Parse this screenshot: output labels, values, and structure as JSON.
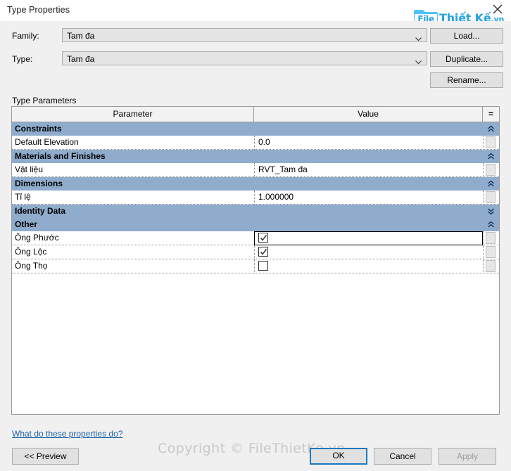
{
  "window": {
    "title": "Type Properties",
    "close_icon": "close-icon"
  },
  "logo": {
    "file_word": "File",
    "main_word": "Thiết Kế",
    "tld": ".vn",
    "color": "#29a3e0"
  },
  "form": {
    "family_label": "Family:",
    "family_value": "Tam đa",
    "type_label": "Type:",
    "type_value": "Tam đa",
    "load_button": "Load...",
    "duplicate_button": "Duplicate...",
    "rename_button": "Rename..."
  },
  "table": {
    "section_label": "Type Parameters",
    "columns": [
      "Parameter",
      "Value",
      "="
    ],
    "rows": [
      {
        "kind": "group",
        "label": "Constraints",
        "state": "expanded"
      },
      {
        "kind": "item",
        "label": "Default Elevation",
        "value": "0.0",
        "value_type": "text",
        "selected": false
      },
      {
        "kind": "group",
        "label": "Materials and Finishes",
        "state": "expanded"
      },
      {
        "kind": "item",
        "label": "Vật liệu",
        "value": "RVT_Tam đa",
        "value_type": "text",
        "selected": false
      },
      {
        "kind": "group",
        "label": "Dimensions",
        "state": "expanded"
      },
      {
        "kind": "item",
        "label": "Tỉ lệ",
        "value": "1.000000",
        "value_type": "text",
        "selected": false
      },
      {
        "kind": "group",
        "label": "Identity Data",
        "state": "collapsed"
      },
      {
        "kind": "group",
        "label": "Other",
        "state": "expanded"
      },
      {
        "kind": "item",
        "label": "Ông Phước",
        "value": "",
        "value_type": "checkbox",
        "checked": true,
        "selected": true
      },
      {
        "kind": "item",
        "label": "Ông Lộc",
        "value": "",
        "value_type": "checkbox",
        "checked": true,
        "selected": false
      },
      {
        "kind": "item",
        "label": "Ông Thọ",
        "value": "",
        "value_type": "checkbox",
        "checked": false,
        "selected": false
      }
    ]
  },
  "footer": {
    "help_link": "What do these properties do?",
    "preview_button": "<< Preview",
    "ok_button": "OK",
    "cancel_button": "Cancel",
    "apply_button": "Apply",
    "apply_disabled": true,
    "watermark": "Copyright © FileThietKe.vn"
  }
}
